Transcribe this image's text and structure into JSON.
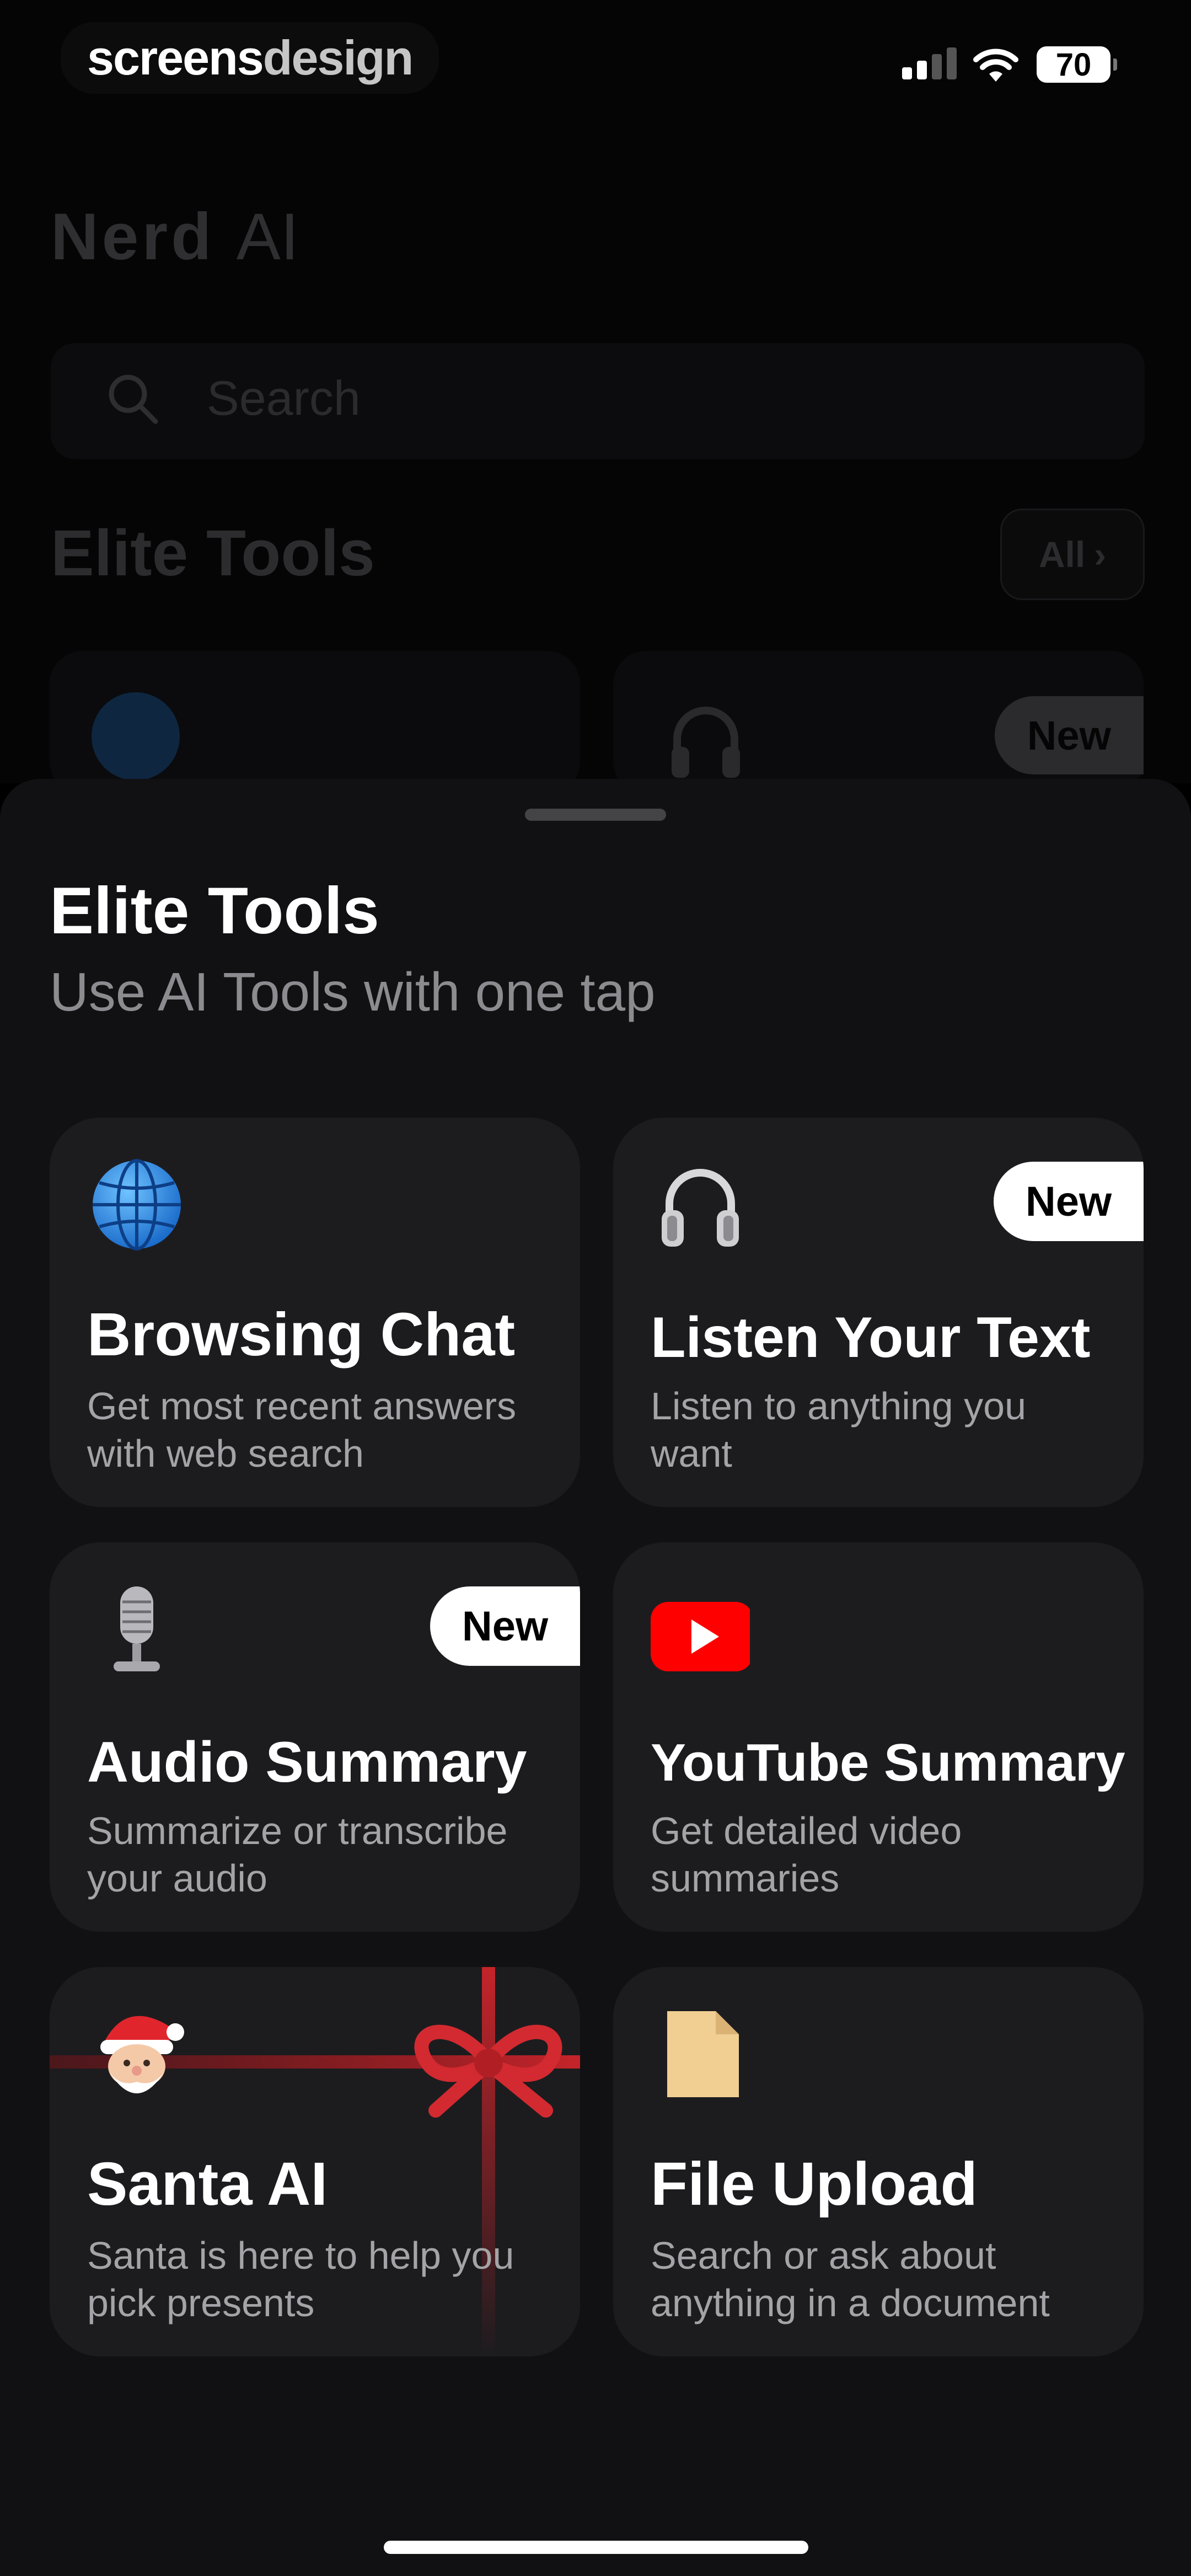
{
  "status_bar": {
    "watermark_bold": "screens",
    "watermark_light": "design",
    "battery": "70"
  },
  "background": {
    "title_bold": "Nerd",
    "title_light": "AI",
    "search_placeholder": "Search",
    "section_title": "Elite Tools",
    "all_label": "All",
    "new_badge": "New"
  },
  "sheet": {
    "title": "Elite Tools",
    "subtitle": "Use AI Tools with one tap",
    "tools": [
      {
        "title": "Browsing Chat",
        "description": "Get most recent answers with web search",
        "icon": "globe-icon",
        "badge": ""
      },
      {
        "title": "Listen Your Text",
        "description": "Listen to anything you want",
        "icon": "headphones-icon",
        "badge": "New"
      },
      {
        "title": "Audio Summary",
        "description": "Summarize or transcribe your audio",
        "icon": "microphone-icon",
        "badge": "New"
      },
      {
        "title": "YouTube Summary",
        "description": "Get detailed video summaries",
        "icon": "youtube-icon",
        "badge": ""
      },
      {
        "title": "Santa AI",
        "description": "Santa is here to help you pick presents",
        "icon": "santa-icon",
        "badge": ""
      },
      {
        "title": "File Upload",
        "description": "Search or ask about anything in a document",
        "icon": "document-icon",
        "badge": ""
      }
    ]
  },
  "colors": {
    "sheet_bg": "#111113",
    "card_bg": "#1c1c1f",
    "ribbon": "#c4242a",
    "youtube_red": "#ff0000"
  }
}
